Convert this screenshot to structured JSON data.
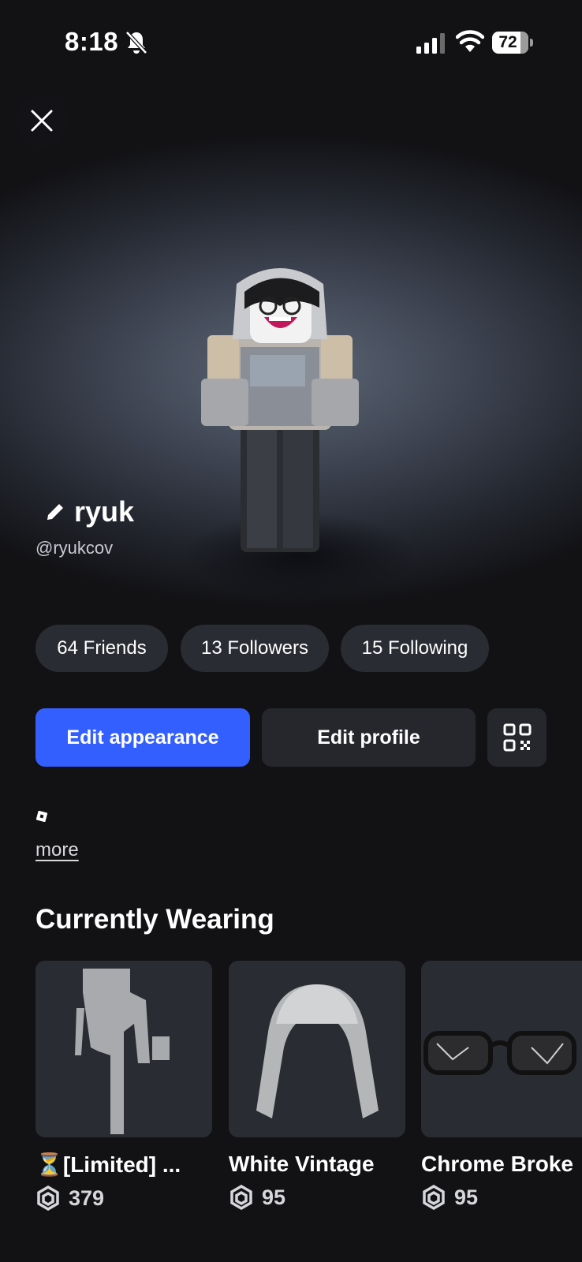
{
  "status_bar": {
    "time": "8:18",
    "battery": "72"
  },
  "profile": {
    "display_name": "ryuk",
    "username": "@ryukcov"
  },
  "stats": {
    "friends": "64 Friends",
    "followers": "13 Followers",
    "following": "15 Following"
  },
  "actions": {
    "edit_appearance": "Edit appearance",
    "edit_profile": "Edit profile"
  },
  "bio": {
    "more": "more"
  },
  "currently_wearing": {
    "title": "Currently Wearing",
    "items": [
      {
        "name": "⏳[Limited] ...",
        "price": "379"
      },
      {
        "name": "White Vintage",
        "price": "95"
      },
      {
        "name": "Chrome Broke",
        "price": "95"
      }
    ]
  },
  "colors": {
    "accent": "#335fff",
    "background": "#121215",
    "pill": "#2a2c33"
  }
}
